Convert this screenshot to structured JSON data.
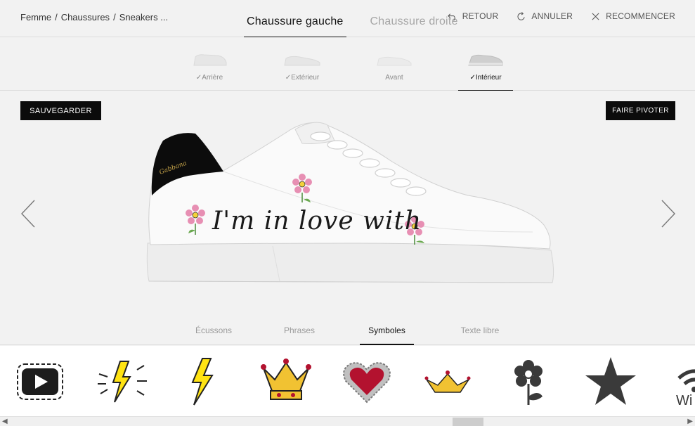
{
  "breadcrumb": [
    "Femme",
    "Chaussures",
    "Sneakers ..."
  ],
  "shoe_tabs": [
    {
      "label": "Chaussure gauche",
      "active": true
    },
    {
      "label": "Chaussure droite",
      "active": false
    }
  ],
  "actions": {
    "back": "RETOUR",
    "undo": "ANNULER",
    "restart": "RECOMMENCER"
  },
  "views": [
    {
      "label": "Arrière",
      "checked": true,
      "active": false
    },
    {
      "label": "Extérieur",
      "checked": true,
      "active": false
    },
    {
      "label": "Avant",
      "checked": false,
      "active": false
    },
    {
      "label": "Intérieur",
      "checked": true,
      "active": true
    }
  ],
  "buttons": {
    "save": "SAUVEGARDER",
    "rotate": "FAIRE PIVOTER"
  },
  "shoe": {
    "script_text": "I'm in love with",
    "brand_text": "Gabbana"
  },
  "categories": [
    {
      "label": "Écussons",
      "active": false
    },
    {
      "label": "Phrases",
      "active": false
    },
    {
      "label": "Symboles",
      "active": true
    },
    {
      "label": "Texte libre",
      "active": false
    }
  ],
  "symbols": [
    {
      "name": "play-button-icon"
    },
    {
      "name": "lightning-burst-icon"
    },
    {
      "name": "lightning-icon"
    },
    {
      "name": "crown-icon"
    },
    {
      "name": "jeweled-heart-icon"
    },
    {
      "name": "small-crown-icon"
    },
    {
      "name": "flower-icon"
    },
    {
      "name": "star-icon"
    },
    {
      "name": "wifi-icon",
      "text": "Wi"
    }
  ],
  "scrollbar": {
    "position": 0.67
  },
  "colors": {
    "background": "#f2f2f2",
    "accent": "#0b0b0b",
    "inactive_text": "#a6a6a6",
    "lightning_yellow": "#ffe312",
    "heart_red": "#b3122f",
    "flower_pink": "#e78fb3"
  }
}
